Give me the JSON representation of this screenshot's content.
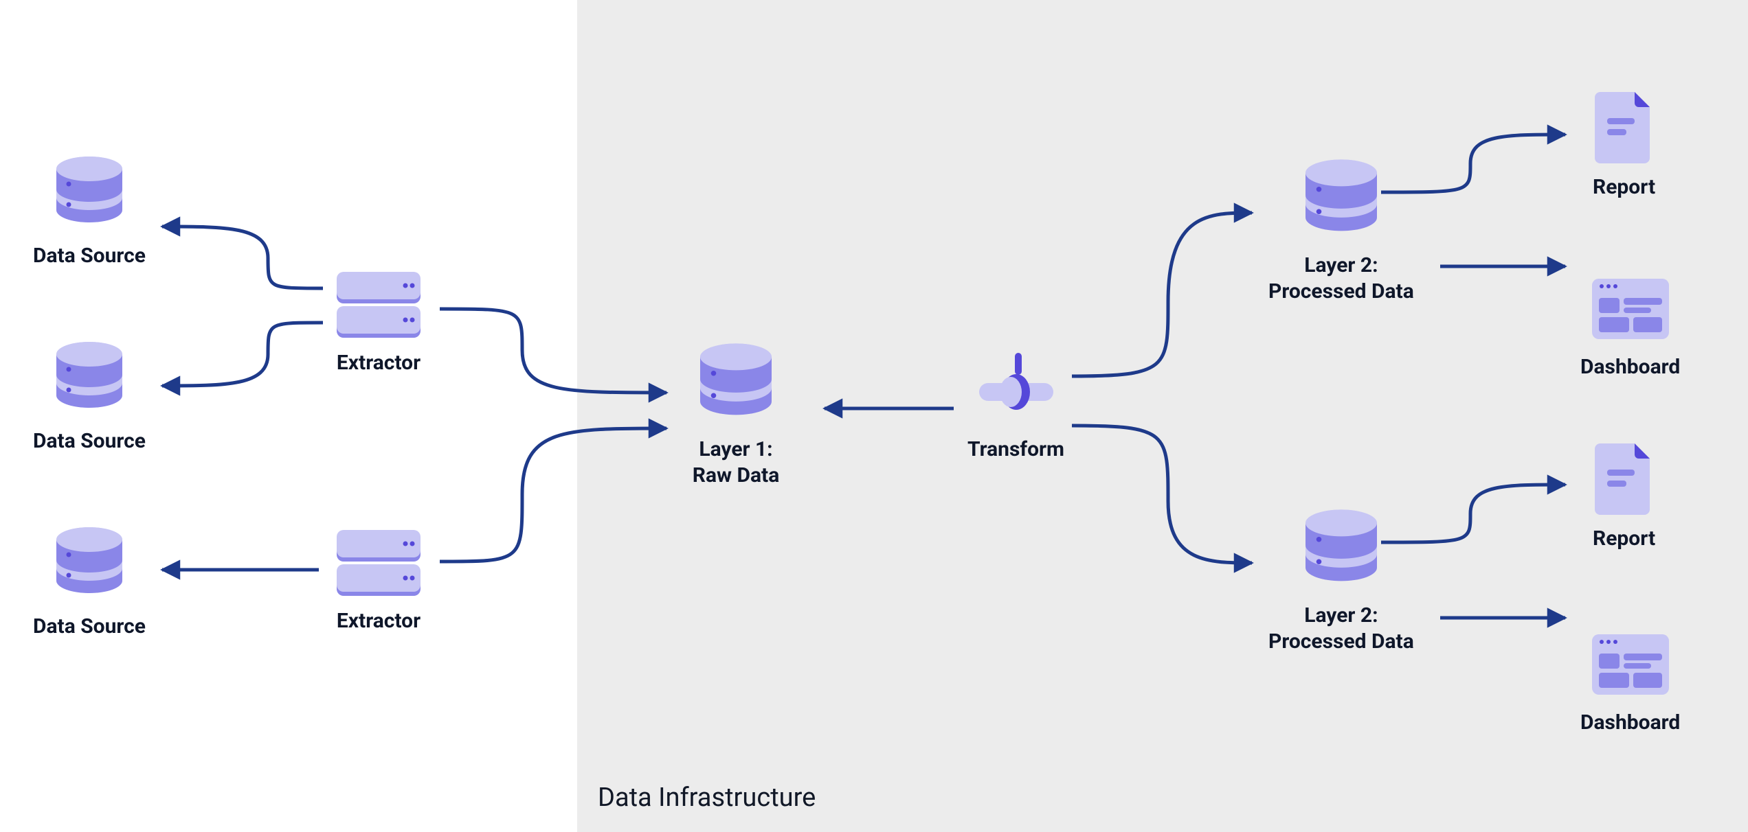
{
  "region": {
    "label": "Data Infrastructure"
  },
  "nodes": {
    "ds1": {
      "label": "Data Source"
    },
    "ds2": {
      "label": "Data Source"
    },
    "ds3": {
      "label": "Data Source"
    },
    "ext1": {
      "label": "Extractor"
    },
    "ext2": {
      "label": "Extractor"
    },
    "layer1": {
      "label": "Layer 1:\nRaw Data"
    },
    "transform": {
      "label": "Transform"
    },
    "layer2a": {
      "label": "Layer 2:\nProcessed Data"
    },
    "layer2b": {
      "label": "Layer 2:\nProcessed Data"
    },
    "report1": {
      "label": "Report"
    },
    "report2": {
      "label": "Report"
    },
    "dash1": {
      "label": "Dashboard"
    },
    "dash2": {
      "label": "Dashboard"
    }
  },
  "colors": {
    "iconLight": "#c7c6f4",
    "iconMid": "#8a86e8",
    "iconDark": "#5548d9",
    "arrow": "#1e3a8a",
    "text": "#0f172a",
    "region": "#ececec"
  }
}
